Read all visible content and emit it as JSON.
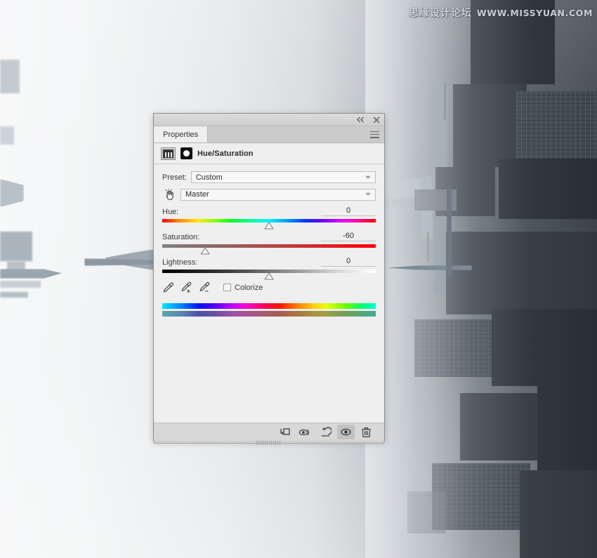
{
  "background": {
    "description": "foggy rotated cityscape photograph",
    "watermark_cn": "思缘设计论坛",
    "watermark_en": "WWW.MISSYUAN.COM"
  },
  "panel": {
    "tab_label": "Properties",
    "menu_icon": "hamburger-menu-icon",
    "collapse_icon": "collapse-double-chevron-icon",
    "close_icon": "close-icon",
    "adjustment_icon": "hue-saturation-adjustment-icon",
    "mask_icon": "layer-mask-thumbnail-icon",
    "adjustment_title": "Hue/Saturation",
    "preset": {
      "label": "Preset:",
      "value": "Custom",
      "caret_icon": "chevron-down-icon"
    },
    "channel": {
      "tool_icon": "on-image-adjustment-hand-icon",
      "value": "Master",
      "caret_icon": "chevron-down-icon"
    },
    "sliders": [
      {
        "name": "Hue:",
        "value": "0",
        "thumb_pct": 50,
        "key": "hue"
      },
      {
        "name": "Saturation:",
        "value": "-60",
        "thumb_pct": 20,
        "key": "saturation"
      },
      {
        "name": "Lightness:",
        "value": "0",
        "thumb_pct": 50,
        "key": "lightness"
      }
    ],
    "tools": [
      {
        "icon": "eyedropper-icon",
        "label": "sample-color"
      },
      {
        "icon": "eyedropper-plus-icon",
        "label": "add-to-sample"
      },
      {
        "icon": "eyedropper-minus-icon",
        "label": "subtract-from-sample"
      }
    ],
    "colorize": {
      "label": "Colorize",
      "checked": false
    },
    "footer_buttons": [
      {
        "icon": "clip-to-layer-icon",
        "name": "clip-to-layer-button",
        "active": false
      },
      {
        "icon": "view-previous-state-icon",
        "name": "view-previous-state-button",
        "active": false
      },
      {
        "icon": "reset-icon",
        "name": "reset-button",
        "active": false
      },
      {
        "icon": "eye-icon",
        "name": "toggle-visibility-button",
        "active": true
      },
      {
        "icon": "trash-icon",
        "name": "delete-adjustment-button",
        "active": false
      }
    ]
  },
  "colors": {
    "panel_bg": "#efefef",
    "panel_chrome": "#d4d4d4",
    "accent_red": "#ff0000",
    "text": "#2b2b2b"
  }
}
